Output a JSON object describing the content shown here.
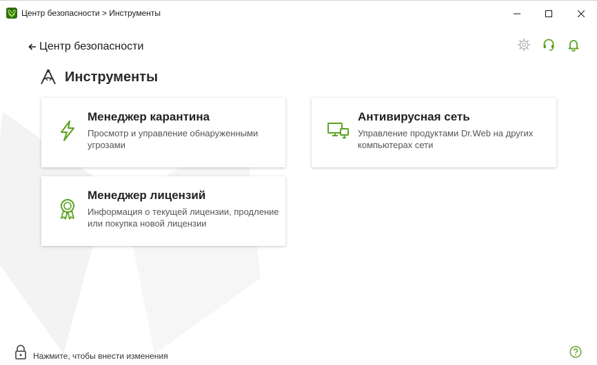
{
  "window": {
    "title": "Центр безопасности > Инструменты"
  },
  "nav": {
    "back_label": "Центр безопасности"
  },
  "page": {
    "title": "Инструменты"
  },
  "cards": [
    {
      "title": "Менеджер карантина",
      "description": "Просмотр и управление обнаруженными угрозами",
      "icon": "lightning-icon"
    },
    {
      "title": "Антивирусная сеть",
      "description": "Управление продуктами Dr.Web на других компьютерах сети",
      "icon": "network-computers-icon"
    },
    {
      "title": "Менеджер лицензий",
      "description": "Информация о текущей лицензии, продление или покупка новой лицензии",
      "icon": "license-award-icon"
    }
  ],
  "status": {
    "text": "Нажмите, чтобы внести изменения"
  },
  "colors": {
    "accent_green": "#5aa21f",
    "icon_gray": "#bdbdbd",
    "text_dark": "#222222",
    "text_muted": "#555555"
  }
}
